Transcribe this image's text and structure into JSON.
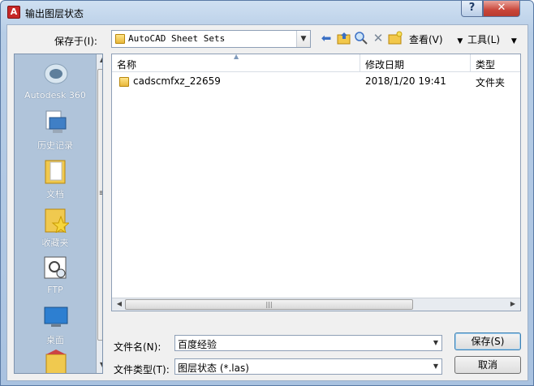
{
  "window": {
    "title": "输出图层状态",
    "help_icon": "?",
    "close_icon": "✕"
  },
  "save_in": {
    "label": "保存于(I):",
    "value": "AutoCAD Sheet Sets"
  },
  "toolbar": {
    "view_label": "查看(V)",
    "tools_label": "工具(L)",
    "icons": [
      "back-arrow-icon",
      "up-folder-icon",
      "search-web-icon",
      "delete-icon",
      "new-folder-icon"
    ]
  },
  "places": [
    {
      "label": "Autodesk 360",
      "icon": "autodesk-360-icon"
    },
    {
      "label": "历史记录",
      "icon": "history-icon"
    },
    {
      "label": "文档",
      "icon": "documents-folder-icon"
    },
    {
      "label": "收藏夹",
      "icon": "favorites-folder-icon"
    },
    {
      "label": "FTP",
      "icon": "ftp-icon"
    },
    {
      "label": "桌面",
      "icon": "desktop-icon"
    }
  ],
  "columns": {
    "name": "名称",
    "modified": "修改日期",
    "type": "类型"
  },
  "files": [
    {
      "name": "cadscmfxz_22659",
      "modified": "2018/1/20 19:41",
      "type": "文件夹"
    }
  ],
  "filename": {
    "label": "文件名(N):",
    "value": "百度经验"
  },
  "filetype": {
    "label": "文件类型(T):",
    "value": "图层状态 (*.las)"
  },
  "buttons": {
    "save": "保存(S)",
    "cancel": "取消"
  }
}
